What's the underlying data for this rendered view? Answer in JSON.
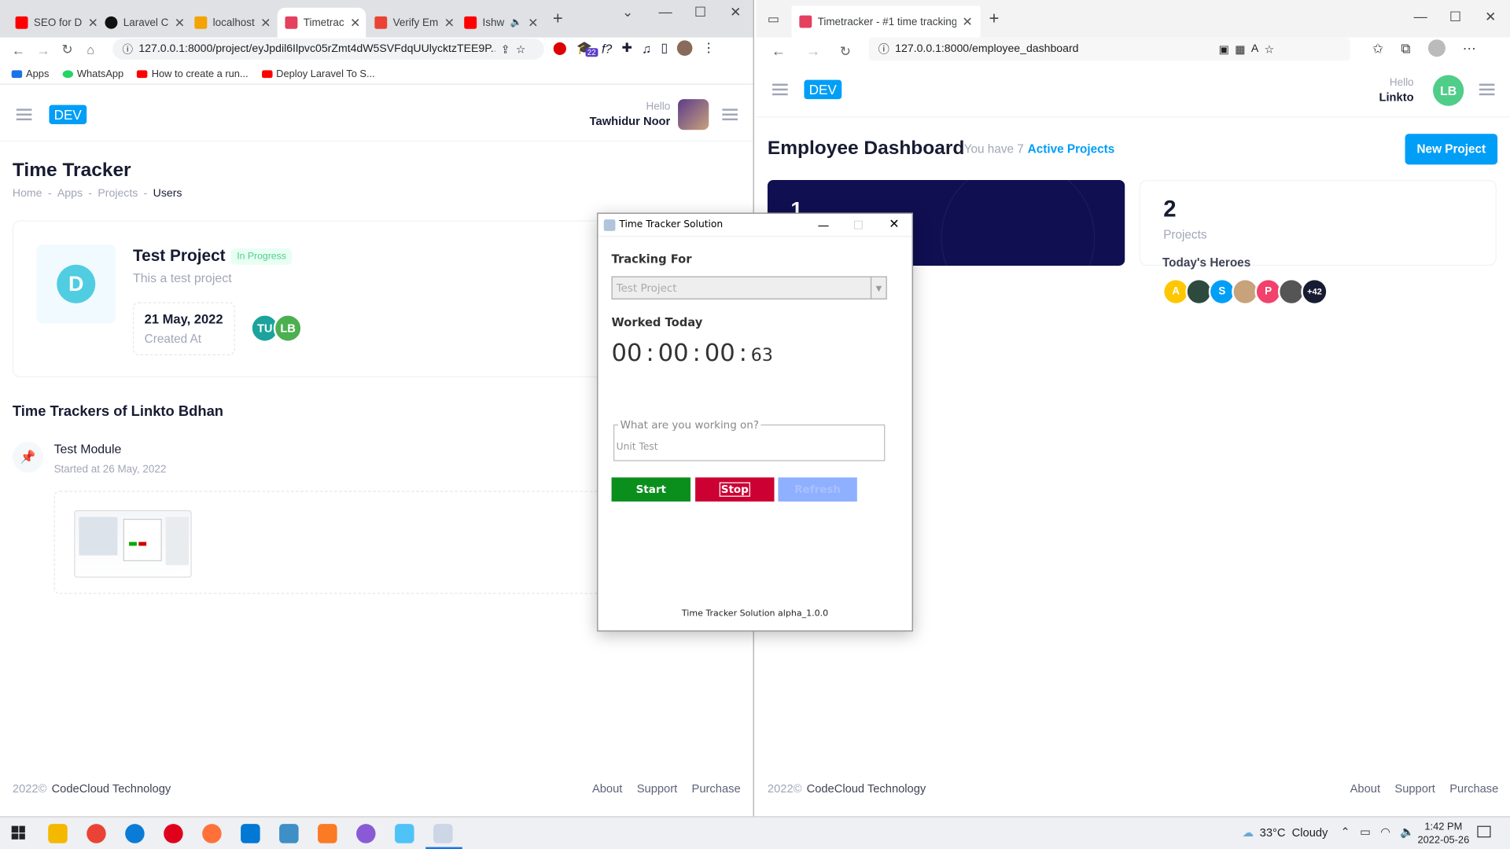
{
  "left_browser": {
    "tabs": [
      {
        "title": "SEO for D",
        "favicon_color": "#ff0000"
      },
      {
        "title": "Laravel C",
        "favicon_color": "#111111"
      },
      {
        "title": "localhost",
        "favicon_color": "#f4a300"
      },
      {
        "title": "Timetrac",
        "favicon_color": "#e4405f"
      },
      {
        "title": "Verify Em",
        "favicon_color": "#ea4335"
      },
      {
        "title": "Ishw",
        "favicon_color": "#ff0000"
      }
    ],
    "url": "127.0.0.1:8000/project/eyJpdil6Ilpvc05rZmt4dW5SVFdqUUlycktzTEE9P...",
    "extension_badge": "22",
    "bookmarks": [
      "Apps",
      "WhatsApp",
      "How to create a run...",
      "Deploy Laravel To S..."
    ],
    "header": {
      "brand": "DEV",
      "hello": "Hello",
      "user_name": "Tawhidur Noor"
    },
    "page_title": "Time Tracker",
    "breadcrumbs": [
      "Home",
      "Apps",
      "Projects",
      "Users"
    ],
    "project": {
      "logo_letter": "D",
      "name": "Test Project",
      "status": "In Progress",
      "description": "This a test project",
      "created_date": "21 May, 2022",
      "created_label": "Created At",
      "members": [
        {
          "initials": "TU",
          "color": "#1ba39c"
        },
        {
          "initials": "LB",
          "color": "#4caf50"
        }
      ]
    },
    "trackers_title": "Time Trackers of Linkto Bdhan",
    "tracker": {
      "module": "Test Module",
      "started": "Started at 26 May, 2022"
    },
    "footer": {
      "copyright": "2022©",
      "company": "CodeCloud Technology",
      "links": [
        "About",
        "Support",
        "Purchase"
      ]
    }
  },
  "right_browser": {
    "tab_title": "Timetracker - #1 time tracking s",
    "url": "127.0.0.1:8000/employee_dashboard",
    "header": {
      "brand": "DEV",
      "hello": "Hello",
      "user_name": "Linkto",
      "avatar_initials": "LB"
    },
    "page_title": "Employee Dashboard",
    "subtitle_prefix": "You have 7",
    "subtitle_link": "Active Projects",
    "new_project_label": "New Project",
    "stat_card_dark_value": "1",
    "stat_card_value": "2",
    "stat_card_label": "Projects",
    "heroes_title": "Today's Heroes",
    "heroes": [
      {
        "label": "A",
        "color": "#ffc700"
      },
      {
        "label": "",
        "color": "#2e4a3f"
      },
      {
        "label": "S",
        "color": "#009ef7"
      },
      {
        "label": "",
        "color": "#c8a27a"
      },
      {
        "label": "P",
        "color": "#f1416c"
      },
      {
        "label": "",
        "color": "#555555"
      },
      {
        "label": "+42",
        "color": "#181c32"
      }
    ],
    "footer": {
      "copyright": "2022©",
      "company": "CodeCloud Technology",
      "links": [
        "About",
        "Support",
        "Purchase"
      ]
    }
  },
  "dialog": {
    "title": "Time Tracker Solution",
    "tracking_label": "Tracking For",
    "project_select": "Test Project",
    "worked_label": "Worked Today",
    "timer": {
      "h": "00",
      "m": "00",
      "s": "00",
      "ms": "63"
    },
    "task_legend": "What are you working on?",
    "task_value": "Unit Test",
    "buttons": {
      "start": "Start",
      "stop": "Stop",
      "refresh": "Refresh"
    },
    "version": "Time Tracker Solution alpha_1.0.0"
  },
  "taskbar": {
    "weather": "33°C  Cloudy",
    "time": "1:42 PM",
    "date": "2022-05-26"
  }
}
